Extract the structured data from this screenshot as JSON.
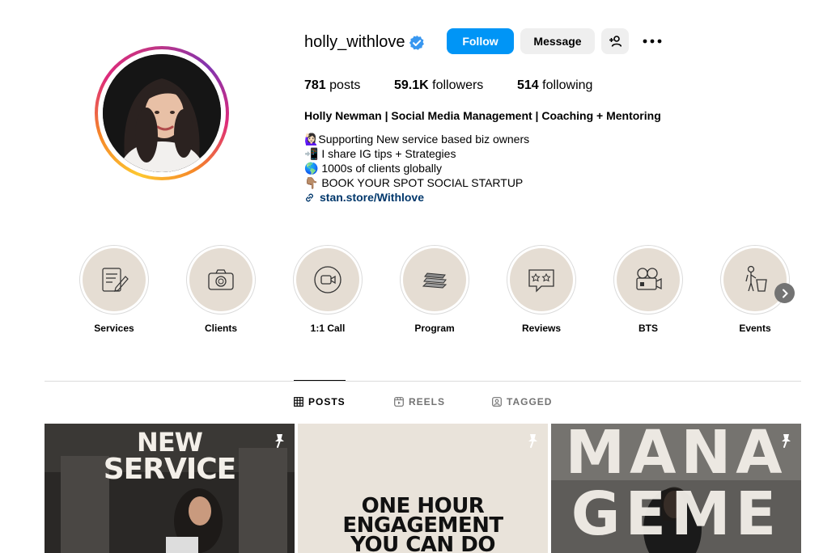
{
  "profile": {
    "username": "holly_withlove",
    "follow_label": "Follow",
    "message_label": "Message",
    "stats": {
      "posts_count": "781",
      "posts_label": "posts",
      "followers_count": "59.1K",
      "followers_label": "followers",
      "following_count": "514",
      "following_label": "following"
    },
    "full_name": "Holly Newman | Social Media Management | Coaching + Mentoring",
    "bio": [
      "🙋🏻‍♀️Supporting New service based biz owners",
      "📲 I share IG tips + Strategies",
      "🌎 1000s of clients globally",
      "👇🏽 BOOK YOUR SPOT SOCIAL STARTUP"
    ],
    "link": "stan.store/Withlove"
  },
  "highlights": [
    {
      "label": "Services",
      "icon": "document-pen-icon"
    },
    {
      "label": "Clients",
      "icon": "camera-icon"
    },
    {
      "label": "1:1 Call",
      "icon": "video-call-icon"
    },
    {
      "label": "Program",
      "icon": "books-stack-icon"
    },
    {
      "label": "Reviews",
      "icon": "star-speech-icon"
    },
    {
      "label": "BTS",
      "icon": "film-camera-icon"
    },
    {
      "label": "Events",
      "icon": "speaker-podium-icon"
    }
  ],
  "tabs": [
    {
      "label": "POSTS",
      "active": true
    },
    {
      "label": "REELS",
      "active": false
    },
    {
      "label": "TAGGED",
      "active": false
    }
  ],
  "posts": [
    {
      "title_line1": "NEW",
      "title_line2": "SERVICE",
      "pinned": true
    },
    {
      "title_line1": "ONE HOUR",
      "title_line2": "ENGAGEMENT",
      "title_line3": "YOU CAN DO",
      "pinned": true
    },
    {
      "title_line1": "MANA",
      "title_line2": "GEME",
      "pinned": true
    }
  ],
  "colors": {
    "accent": "#0095f6",
    "link": "#00376b",
    "highlight_bg": "#e5ddd3"
  }
}
